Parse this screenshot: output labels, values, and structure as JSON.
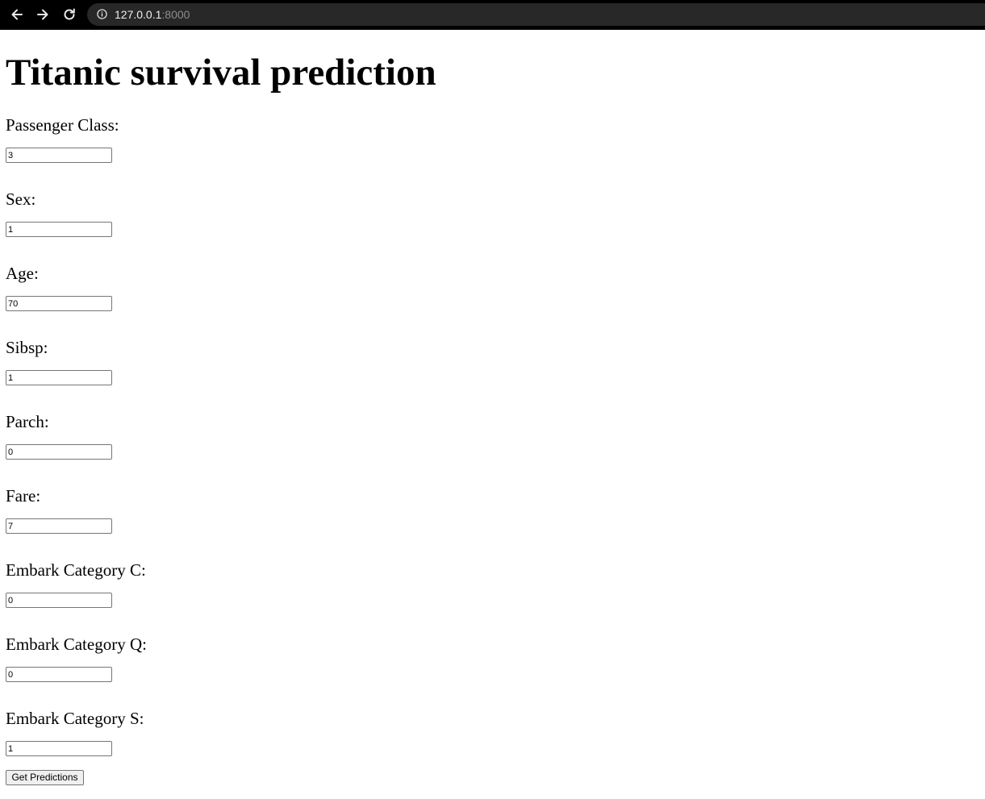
{
  "browser": {
    "url_host": "127.0.0.1",
    "url_port": ":8000"
  },
  "page": {
    "title": "Titanic survival prediction"
  },
  "form": {
    "fields": [
      {
        "label": "Passenger Class:",
        "value": "3"
      },
      {
        "label": "Sex:",
        "value": "1"
      },
      {
        "label": "Age:",
        "value": "70"
      },
      {
        "label": "Sibsp:",
        "value": "1"
      },
      {
        "label": "Parch:",
        "value": "0"
      },
      {
        "label": "Fare:",
        "value": "7"
      },
      {
        "label": "Embark Category C:",
        "value": "0"
      },
      {
        "label": "Embark Category Q:",
        "value": "0"
      },
      {
        "label": "Embark Category S:",
        "value": "1"
      }
    ],
    "submit_label": "Get Predictions"
  }
}
